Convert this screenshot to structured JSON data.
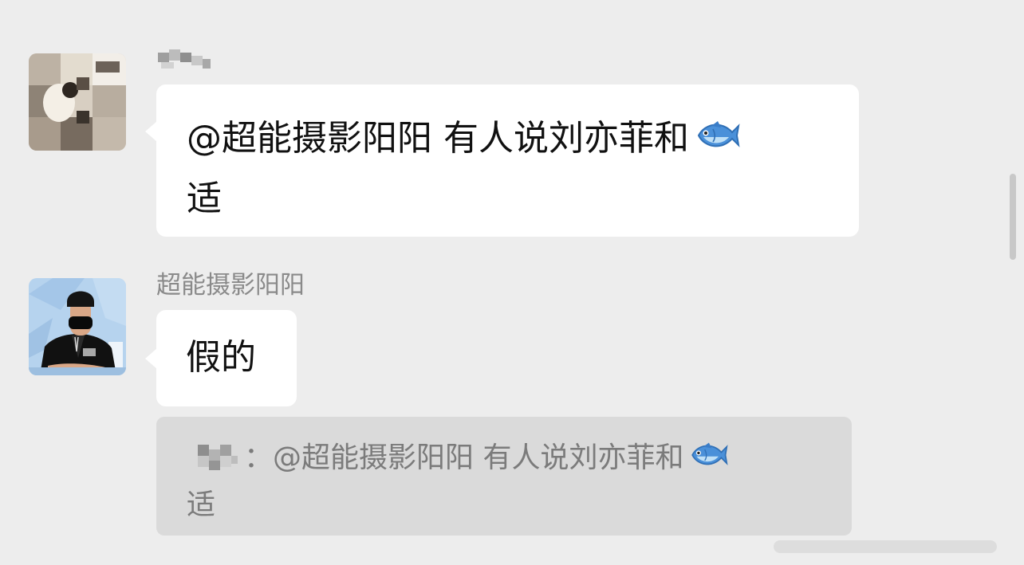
{
  "messages": [
    {
      "sender_name": "",
      "text_line1": "@超能摄影阳阳 有人说刘亦菲和",
      "text_line2": "适",
      "emoji": "fish-emoji"
    },
    {
      "sender_name": "超能摄影阳阳",
      "text": "假的",
      "quote": {
        "author_separator": "：",
        "text_line1": "@超能摄影阳阳 有人说刘亦菲和",
        "text_line2": "适",
        "emoji": "fish-emoji"
      }
    }
  ],
  "colors": {
    "background": "#ededed",
    "bubble": "#ffffff",
    "quote_background": "#dadada",
    "quote_text": "#7b7b7b",
    "sender_text": "#8a8a8a"
  }
}
